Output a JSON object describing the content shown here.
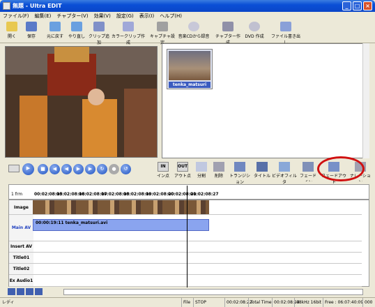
{
  "window": {
    "title": "無題 - Ultra EDIT"
  },
  "menu": [
    "ファイル(F)",
    "編集(E)",
    "チャプター(V)",
    "効果(V)",
    "設定(G)",
    "表示(I)",
    "ヘルプ(H)"
  ],
  "toolbar": {
    "open": "開く",
    "save": "保存",
    "undo": "元に戻す",
    "redo": "やり直し",
    "add_clip": "クリップ追加",
    "color_clip": "カラークリップ作成",
    "capture_settings": "キャプチャ設定",
    "cd_record": "音楽CDから録音",
    "chapter_create": "チャプター作成",
    "dvd_create": "DVD 作成",
    "file_write": "ファイル書き出し"
  },
  "bin": {
    "clip_label": "tenka_matsuri"
  },
  "edit": {
    "in_point": "イン点",
    "out_point": "アウト点",
    "split": "分割",
    "delete": "削除",
    "transition": "トランジション",
    "title": "タイトル",
    "video_filter": "ビデオフィルタ",
    "fade_in": "フェードイン",
    "fade_out": "フェードアウト",
    "narration": "ナレーション",
    "in_label": "IN",
    "out_label": "OUT"
  },
  "ruler": {
    "scale": "1 frm",
    "times": [
      "00:02:08:15",
      "00:02:08:16",
      "00:02:08:17",
      "00:02:08:18",
      "00:02:08:19",
      "00:02:08:20",
      "00:02:08:21",
      "00:02:08:27"
    ]
  },
  "tracks": [
    "Image",
    "Main AV",
    "Insert AV",
    "Title01",
    "Title02",
    "Ex Audio1"
  ],
  "mainav_clip": "00:00:19:11  tenka_matsuri.avi",
  "status": {
    "ready": "レディ",
    "file": "File",
    "stop": "STOP",
    "pos": "00:02:08:22",
    "total_label": "Total Time",
    "total": "00:02:08:23",
    "audio": "48kHz 16bit",
    "free": "Free : 06:07:40:09",
    "free_val": "000"
  }
}
